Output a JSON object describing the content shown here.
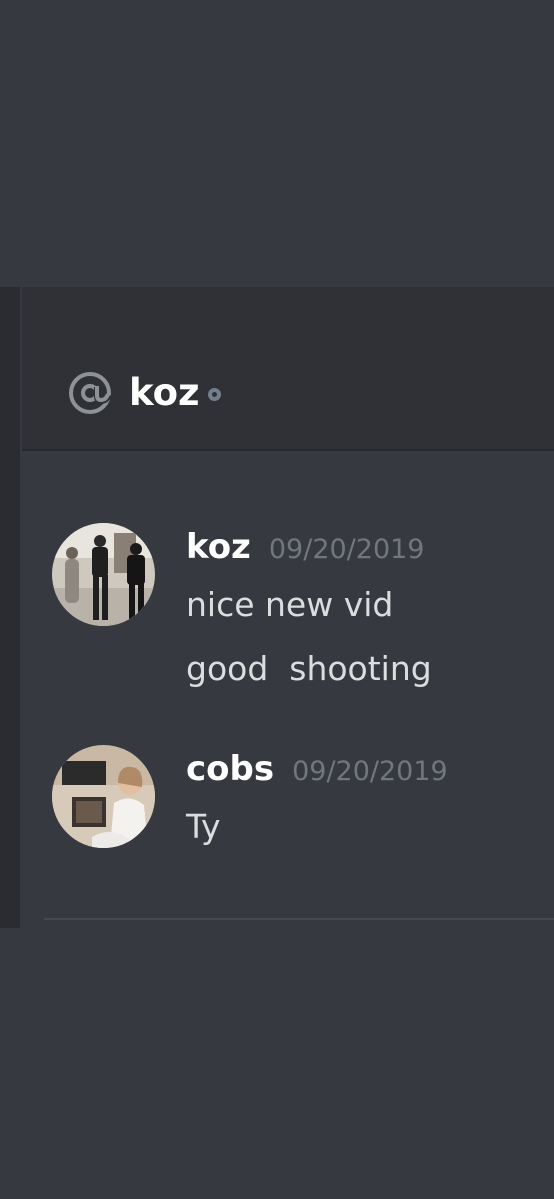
{
  "channel": {
    "title": "koz",
    "icon": "at-icon",
    "status": "offline-status-dot"
  },
  "messages": [
    {
      "author": "koz",
      "timestamp": "09/20/2019",
      "lines": [
        "nice new vid",
        "good  shooting"
      ]
    },
    {
      "author": "cobs",
      "timestamp": "09/20/2019",
      "lines": [
        "Ty"
      ]
    }
  ],
  "colors": {
    "background": "#36393f",
    "header": "#2f3136",
    "username": "#ffffff",
    "timestamp": "#72767d",
    "message_text": "#dcddde",
    "status": "#747f8d"
  }
}
